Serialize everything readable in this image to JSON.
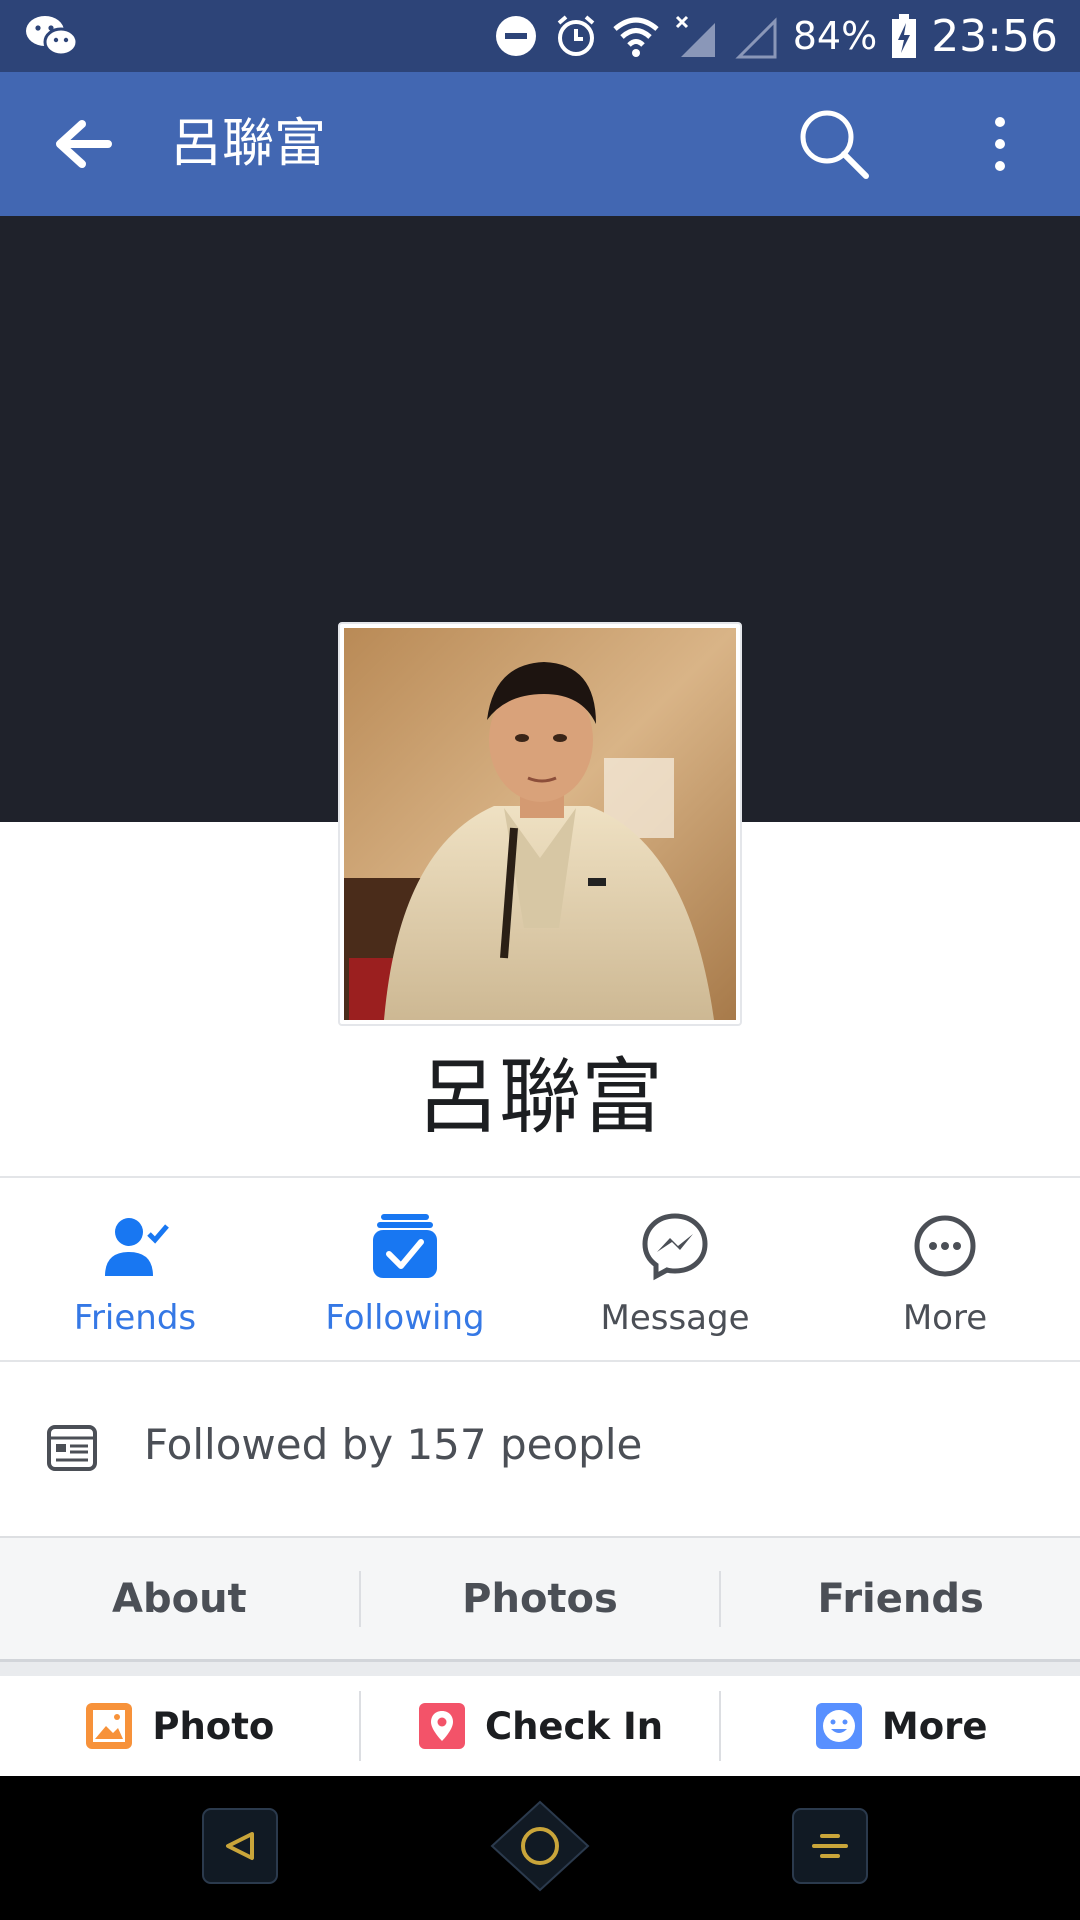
{
  "status_bar": {
    "left_icon": "wechat-icon",
    "battery": "84%",
    "time": "23:56",
    "icons": [
      "do-not-disturb-icon",
      "alarm-icon",
      "wifi-icon",
      "signal-icon",
      "signal-empty-icon",
      "battery-charging-icon"
    ]
  },
  "app_bar": {
    "back_icon": "arrow-left-icon",
    "title": "呂聯富",
    "search_icon": "search-icon",
    "menu_icon": "more-vertical-icon",
    "color": "#4267b2"
  },
  "profile": {
    "name": "呂聯富",
    "cover_color": "#1f222b"
  },
  "actions": [
    {
      "label": "Friends",
      "icon": "friends-check-icon",
      "active": true
    },
    {
      "label": "Following",
      "icon": "following-check-icon",
      "active": true
    },
    {
      "label": "Message",
      "icon": "messenger-icon",
      "active": false
    },
    {
      "label": "More",
      "icon": "more-horizontal-icon",
      "active": false
    }
  ],
  "followed": {
    "text": "Followed by 157 people",
    "icon": "followers-card-icon"
  },
  "tabs": [
    "About",
    "Photos",
    "Friends"
  ],
  "composer": [
    {
      "label": "Photo",
      "icon": "photo-icon"
    },
    {
      "label": "Check In",
      "icon": "location-pin-icon"
    },
    {
      "label": "More",
      "icon": "smiley-icon"
    }
  ],
  "nav_bar": [
    "back-triangle-icon",
    "home-circle-icon",
    "recents-icon"
  ],
  "colors": {
    "accent": "#1877f2",
    "active_text": "#3578e5",
    "inactive_text": "#4b4f56"
  }
}
